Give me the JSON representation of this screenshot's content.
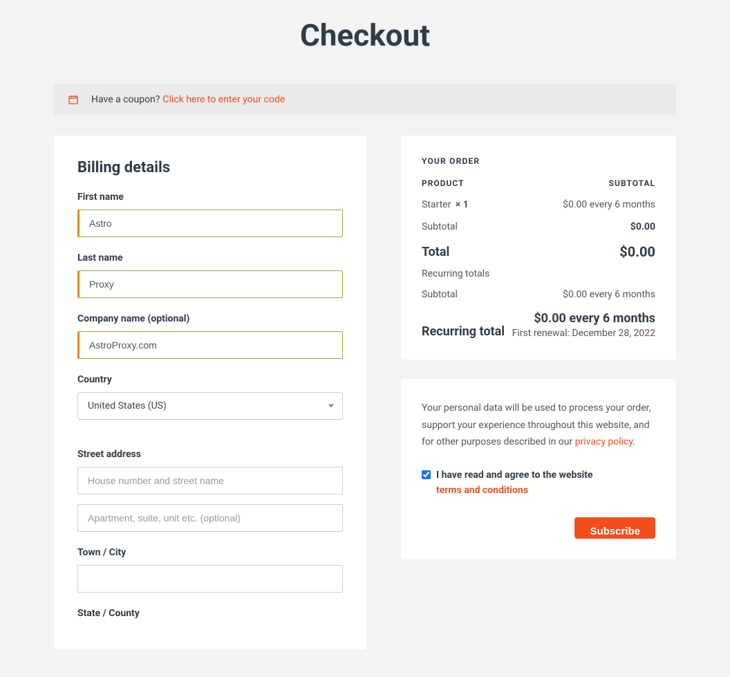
{
  "page_title": "Checkout",
  "coupon": {
    "prompt": "Have a coupon?",
    "link_text": "Click here to enter your code"
  },
  "billing": {
    "title": "Billing details",
    "first_name_label": "First name",
    "first_name_value": "Astro",
    "last_name_label": "Last name",
    "last_name_value": "Proxy",
    "company_label": "Company name (optional)",
    "company_value": "AstroProxy.com",
    "country_label": "Country",
    "country_value": "United States (US)",
    "street_label": "Street address",
    "street_placeholder1": "House number and street name",
    "street_value1": "",
    "street_placeholder2": "Apartment, suite, unit etc. (optional)",
    "street_value2": "",
    "town_label": "Town / City",
    "town_value": "",
    "state_label": "State / County"
  },
  "order": {
    "header": "YOUR ORDER",
    "col_product": "PRODUCT",
    "col_subtotal": "SUBTOTAL",
    "item_name": "Starter",
    "item_qty": "× 1",
    "item_subtotal": "$0.00 every 6 months",
    "subtotal_label": "Subtotal",
    "subtotal_value": "$0.00",
    "total_label": "Total",
    "total_value": "$0.00",
    "recurring_header": "Recurring totals",
    "recurring_subtotal_label": "Subtotal",
    "recurring_subtotal_value": "$0.00 every 6 months",
    "recurring_total_label": "Recurring total",
    "recurring_total_value": "$0.00 every 6 months",
    "first_renewal": "First renewal: December 28, 2022"
  },
  "privacy": {
    "text": "Your personal data will be used to process your order, support your experience throughout this website, and for other purposes described in our ",
    "policy_link": "privacy policy",
    "period": ".",
    "agree_text_1": "I have read and agree to the website ",
    "terms_link": "terms and conditions",
    "subscribe": "Subscribe",
    "checked": true
  }
}
